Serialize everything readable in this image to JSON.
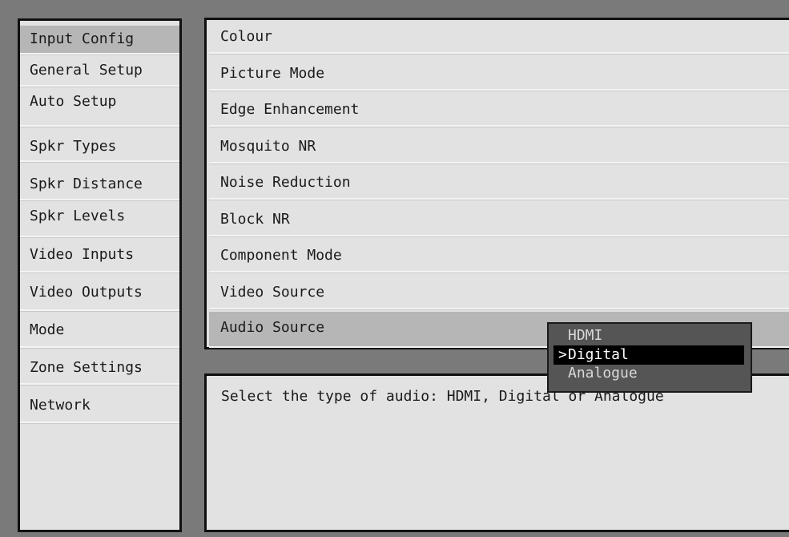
{
  "sidebar": {
    "items": [
      {
        "label": "Input Config",
        "selected": true
      },
      {
        "label": "General Setup",
        "selected": false
      },
      {
        "label": "Auto Setup",
        "selected": false
      },
      {
        "label": "Spkr Types",
        "selected": false
      },
      {
        "label": "Spkr Distance",
        "selected": false
      },
      {
        "label": "Spkr Levels",
        "selected": false
      },
      {
        "label": "Video Inputs",
        "selected": false
      },
      {
        "label": "Video Outputs",
        "selected": false
      },
      {
        "label": "Mode",
        "selected": false
      },
      {
        "label": "Zone Settings",
        "selected": false
      },
      {
        "label": "Network",
        "selected": false
      }
    ]
  },
  "main_menu": {
    "items": [
      {
        "label": "Colour",
        "selected": false
      },
      {
        "label": "Picture Mode",
        "selected": false
      },
      {
        "label": "Edge Enhancement",
        "selected": false
      },
      {
        "label": "Mosquito NR",
        "selected": false
      },
      {
        "label": "Noise Reduction",
        "selected": false
      },
      {
        "label": "Block NR",
        "selected": false
      },
      {
        "label": "Component Mode",
        "selected": false
      },
      {
        "label": "Video Source",
        "selected": false
      },
      {
        "label": "Audio Source",
        "selected": true
      }
    ]
  },
  "dropdown": {
    "selected_marker": ">",
    "options": [
      {
        "label": "HDMI",
        "selected": false
      },
      {
        "label": "Digital",
        "selected": true
      },
      {
        "label": "Analogue",
        "selected": false
      }
    ]
  },
  "help": {
    "text": "Select the type of audio: HDMI, Digital or Analogue"
  },
  "colors": {
    "frame": "#7a7a7a",
    "panel": "#e2e2e2",
    "highlight": "#b6b6b6",
    "dropdown_bg": "#555555",
    "dropdown_selected": "#000000"
  }
}
